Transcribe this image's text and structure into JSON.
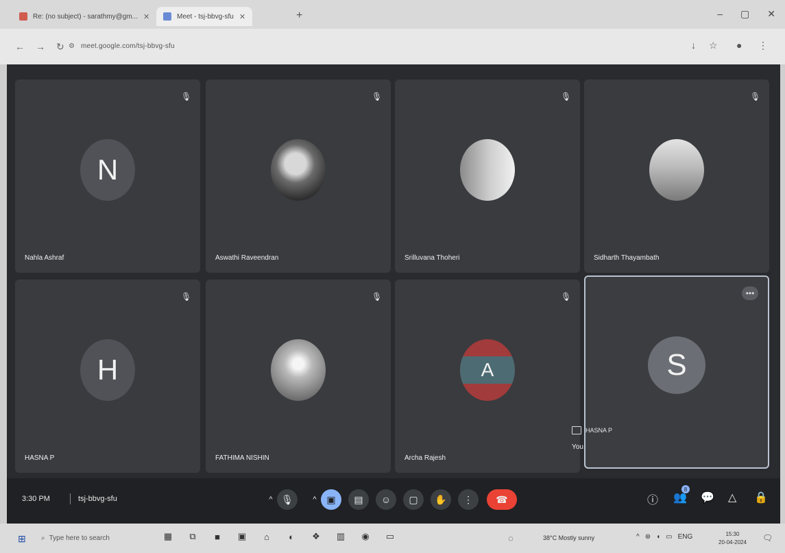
{
  "browser": {
    "tabs": [
      {
        "label": "Re: (no subject) - sarathmy@gm..."
      },
      {
        "label": "Meet - tsj-bbvg-sfu"
      }
    ],
    "url": "meet.google.com/tsj-bbvg-sfu",
    "new_tab": "+",
    "win": {
      "min": "–",
      "max": "▢",
      "close": "✕"
    }
  },
  "meet": {
    "participants": [
      {
        "name": "Nahla Ashraf",
        "initial": "N"
      },
      {
        "name": "Aswathi Raveendran",
        "initial": ""
      },
      {
        "name": "Srilluvana Thoheri",
        "initial": ""
      },
      {
        "name": "Sidharth Thayambath",
        "initial": ""
      },
      {
        "name": "HASNA P",
        "initial": "H"
      },
      {
        "name": "FATHIMA NISHIN",
        "initial": ""
      },
      {
        "name": "Archa Rajesh",
        "initial": "A"
      },
      {
        "name": "You",
        "initial": "S",
        "presenting": "HASNA P"
      }
    ],
    "time": "3:30 PM",
    "meeting_code": "tsj-bbvg-sfu",
    "participants_count": "8"
  },
  "taskbar": {
    "search_placeholder": "Type here to search",
    "weather": "38°C Mostly sunny",
    "lang": "ENG",
    "clock_time": "15:30",
    "clock_date": "20-04-2024"
  }
}
